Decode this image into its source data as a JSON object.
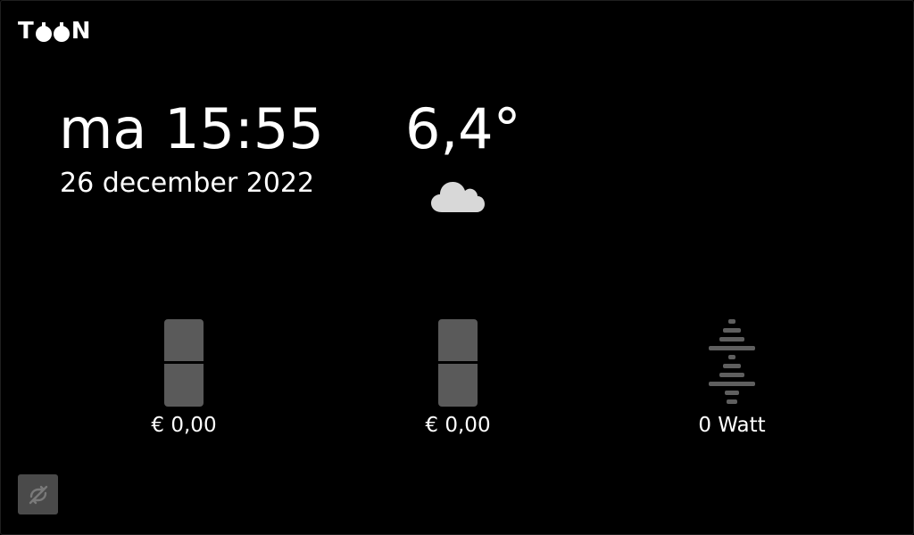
{
  "logo": {
    "letter_left": "T",
    "letter_right": "N",
    "brand_color": "#ffffff"
  },
  "clock": {
    "day_time": "ma 15:55",
    "date": "26 december 2022"
  },
  "weather": {
    "temperature": "6,4°",
    "icon": "cloud-icon"
  },
  "tiles": {
    "gas": {
      "label": "€ 0,00",
      "icon": "meter-bar-icon"
    },
    "electricity": {
      "label": "€ 0,00",
      "icon": "meter-bar-icon"
    },
    "power": {
      "label": "0 Watt",
      "icon": "power-wave-icon"
    }
  },
  "status": {
    "sync_icon": "sync-off-icon"
  },
  "colors": {
    "background": "#000000",
    "text": "#ffffff",
    "tile_meter": "#5a5a5a",
    "button": "#4a4a4a",
    "cloud": "#d8d8d8"
  }
}
